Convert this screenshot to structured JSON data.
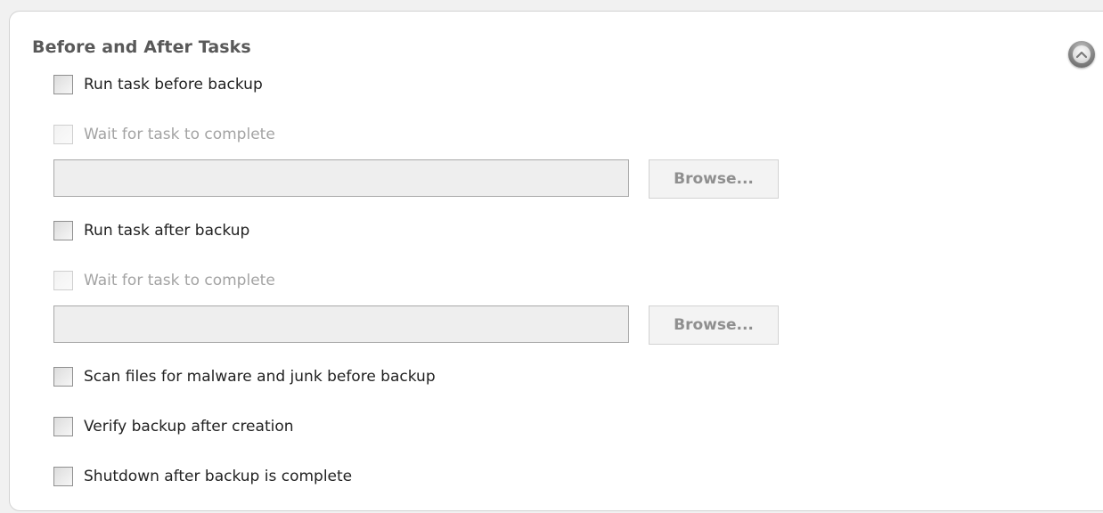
{
  "section": {
    "title": "Before and After Tasks",
    "collapse_icon": "chevron-up-icon"
  },
  "options": {
    "run_before": {
      "label": "Run task before backup",
      "checked": false
    },
    "wait_before": {
      "label": "Wait for task to complete",
      "checked": false,
      "enabled": false
    },
    "before_path": {
      "value": ""
    },
    "browse_before": {
      "label": "Browse..."
    },
    "run_after": {
      "label": "Run task after backup",
      "checked": false
    },
    "wait_after": {
      "label": "Wait for task to complete",
      "checked": false,
      "enabled": false
    },
    "after_path": {
      "value": ""
    },
    "browse_after": {
      "label": "Browse..."
    },
    "scan_files": {
      "label": "Scan files for malware and junk before backup",
      "checked": false
    },
    "verify_backup": {
      "label": "Verify backup after creation",
      "checked": false
    },
    "shutdown": {
      "label": "Shutdown after backup is complete",
      "checked": false
    }
  }
}
